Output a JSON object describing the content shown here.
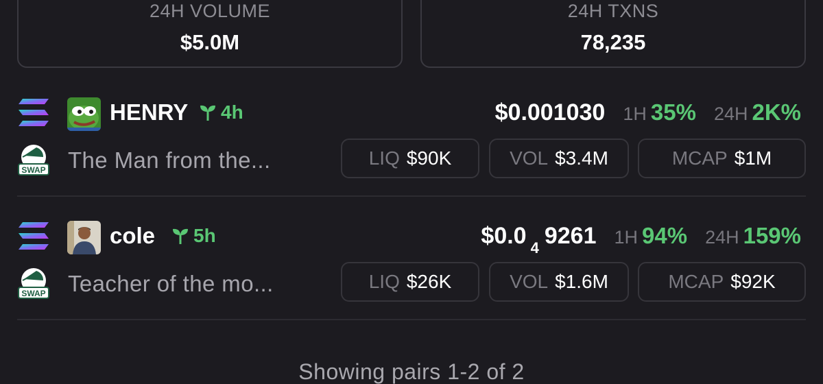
{
  "stats": {
    "volume": {
      "label": "24H VOLUME",
      "value": "$5.0M"
    },
    "txns": {
      "label": "24H TXNS",
      "value": "78,235"
    }
  },
  "pairs": [
    {
      "chain_icon": "solana-icon",
      "dex_icon": "swap-icon",
      "dex_label": "SWAP",
      "avatar": "pepe-frog-avatar",
      "name": "HENRY",
      "age": "4h",
      "description": "The Man from the...",
      "price": "$0.001030",
      "price_prefix": "",
      "price_sub": "",
      "price_rest": "",
      "h1_label": "1H",
      "h1_value": "35%",
      "h24_label": "24H",
      "h24_value": "2K%",
      "liq_label": "LIQ",
      "liq_value": "$90K",
      "vol_label": "VOL",
      "vol_value": "$3.4M",
      "mcap_label": "MCAP",
      "mcap_value": "$1M",
      "change_color": "#5ac774"
    },
    {
      "chain_icon": "solana-icon",
      "dex_icon": "swap-icon",
      "dex_label": "SWAP",
      "avatar": "person-photo-avatar",
      "name": "cole",
      "age": "5h",
      "description": "Teacher of the mo...",
      "price_prefix": "$0.0",
      "price_sub": "4",
      "price_rest": "9261",
      "h1_label": "1H",
      "h1_value": "94%",
      "h24_label": "24H",
      "h24_value": "159%",
      "liq_label": "LIQ",
      "liq_value": "$26K",
      "vol_label": "VOL",
      "vol_value": "$1.6M",
      "mcap_label": "MCAP",
      "mcap_value": "$92K",
      "change_color": "#5ac774"
    }
  ],
  "footer": {
    "text": "Showing pairs 1-2 of 2"
  }
}
